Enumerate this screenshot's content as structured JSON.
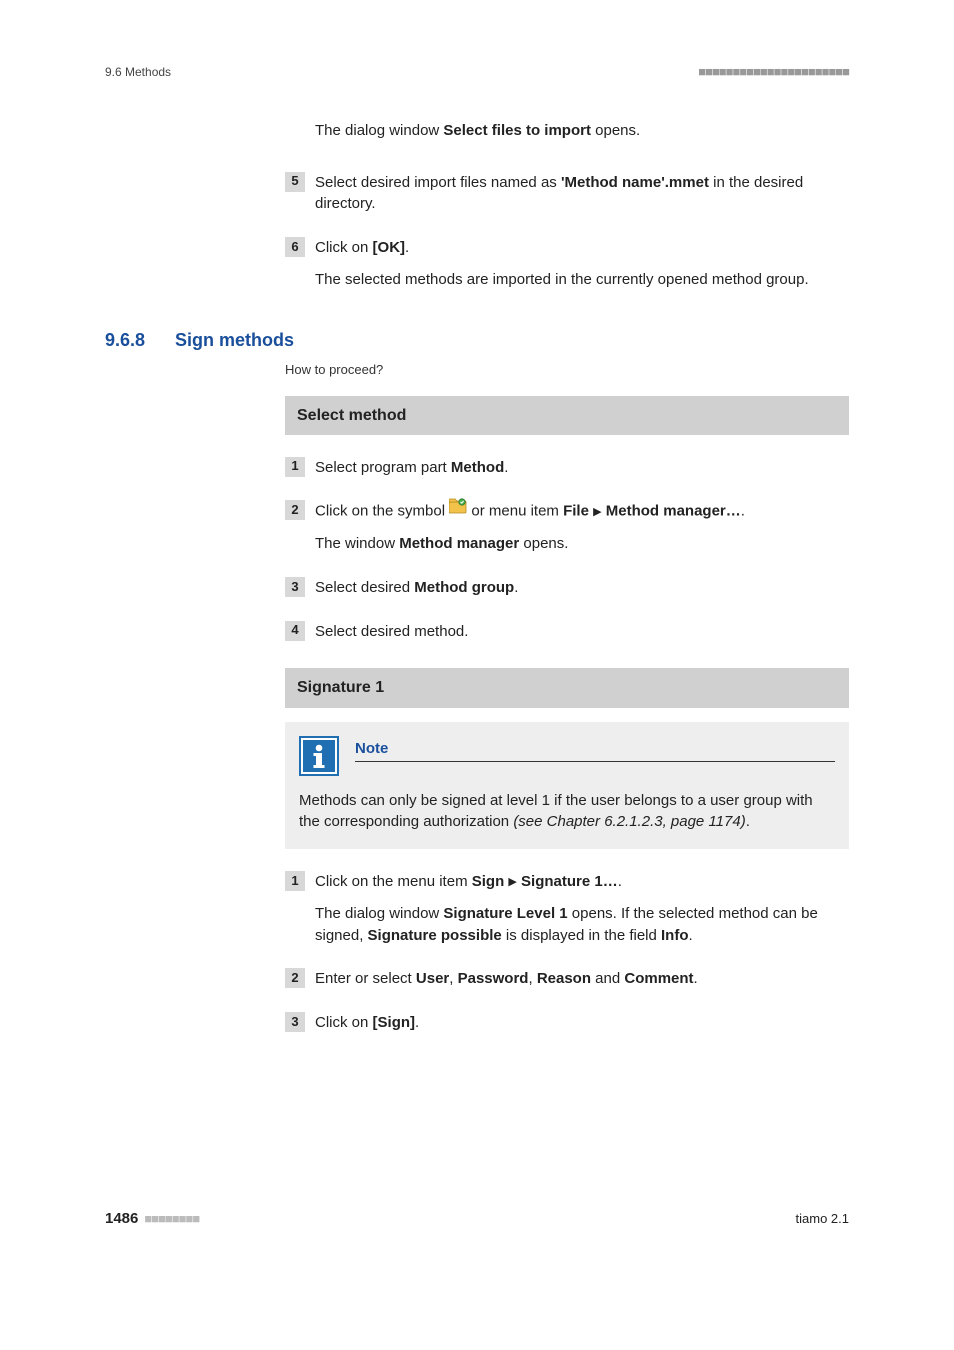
{
  "header": {
    "left": "9.6 Methods",
    "dashes": "■■■■■■■■■■■■■■■■■■■■■■"
  },
  "intro": {
    "pre": "The dialog window ",
    "bold": "Select files to import",
    "post": " opens."
  },
  "steps_top": [
    {
      "num": "5",
      "parts": [
        "Select desired import files named as ",
        "'Method name'.mmet",
        " in the desired directory."
      ]
    },
    {
      "num": "6",
      "parts": [
        "Click on ",
        "[OK]",
        "."
      ],
      "result": "The selected methods are imported in the currently opened method group."
    }
  ],
  "section": {
    "number": "9.6.8",
    "title": "Sign methods",
    "howto": "How to proceed?"
  },
  "band1": "Select method",
  "sel_steps": {
    "s1": {
      "num": "1",
      "a": "Select program part ",
      "b": "Method",
      "c": "."
    },
    "s2": {
      "num": "2",
      "a": "Click on the symbol ",
      "b": " or menu item ",
      "c": "File",
      "d": "Method manager…",
      "e": ".",
      "res_a": "The window ",
      "res_b": "Method manager",
      "res_c": " opens."
    },
    "s3": {
      "num": "3",
      "a": "Select desired ",
      "b": "Method group",
      "c": "."
    },
    "s4": {
      "num": "4",
      "a": "Select desired method."
    }
  },
  "band2": "Signature 1",
  "note": {
    "title": "Note",
    "body_a": "Methods can only be signed at level 1 if the user belongs to a user group with the corresponding authorization ",
    "body_ital": "(see Chapter 6.2.1.2.3, page 1174)",
    "body_c": "."
  },
  "sig_steps": {
    "s1": {
      "num": "1",
      "a": "Click on the menu item ",
      "b": "Sign",
      "c": "Signature 1…",
      "d": ".",
      "res_a": "The dialog window ",
      "res_b": "Signature Level 1",
      "res_c": " opens. If the selected method can be signed, ",
      "res_d": "Signature possible",
      "res_e": " is displayed in the field ",
      "res_f": "Info",
      "res_g": "."
    },
    "s2": {
      "num": "2",
      "a": "Enter or select ",
      "b": "User",
      "c": ", ",
      "d": "Password",
      "e": ", ",
      "f": "Reason",
      "g": " and ",
      "h": "Comment",
      "i": "."
    },
    "s3": {
      "num": "3",
      "a": "Click on ",
      "b": "[Sign]",
      "c": "."
    }
  },
  "footer": {
    "page": "1486",
    "dashes": "■■■■■■■■",
    "right": "tiamo 2.1"
  },
  "glyphs": {
    "tri": "▶"
  }
}
